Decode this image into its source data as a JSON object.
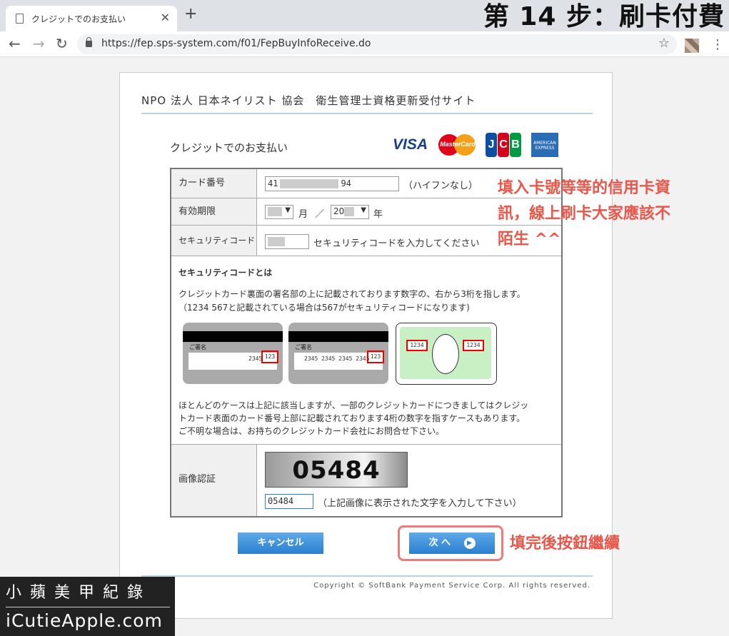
{
  "browser": {
    "tab_title": "クレジットでのお支払い",
    "new_tab": "+",
    "close_tab": "✕",
    "url": "https://fep.sps-system.com/f01/FepBuyInfoReceive.do",
    "nav": {
      "back": "←",
      "forward": "→",
      "reload": "↻"
    },
    "star": "☆",
    "menu": "⋮"
  },
  "step_title": "第 14 步：刷卡付費",
  "page": {
    "site_title": "NPO 法人 日本ネイリスト 協会　衛生管理士資格更新受付サイト",
    "heading": "クレジットでのお支払い",
    "card_brands": {
      "visa": "VISA",
      "mastercard": "MasterCard",
      "jcb": [
        "J",
        "C",
        "B"
      ],
      "amex": "AMERICAN EXPRESS"
    },
    "form": {
      "card_number": {
        "label": "カード番号",
        "value_prefix": "41",
        "value_suffix": "94",
        "note": "（ハイフンなし）"
      },
      "expiry": {
        "label": "有効期限",
        "month_unit": "月",
        "separator": "／",
        "year_prefix": "20",
        "year_unit": "年"
      },
      "security_code": {
        "label": "セキュリティコード",
        "note": "セキュリティコードを入力してください"
      },
      "security_info": {
        "title": "セキュリティコードとは",
        "desc1": "クレジットカード裏面の署名部の上に記載されております数字の、右から3桁を指します。",
        "desc2": "（1234 567と記載されている場合は567がセキュリティコードになります)",
        "sample1": {
          "sign_label": "ご署名",
          "digits": "2345",
          "code": "123"
        },
        "sample2": {
          "sign_label": "ご署名",
          "digits": "2345 2345 2345 2345",
          "code": "123"
        },
        "sample3": {
          "code_left": "1234",
          "code_right": "1234"
        },
        "desc3": "ほとんどのケースは上記に該当しますが、一部のクレジットカードにつきましてはクレジッ",
        "desc4": "トカード表面のカード番号上部に記載されております4桁の数字を指すケースもあります。",
        "desc5": "ご不明な場合は、お持ちのクレジットカード会社にお問合せ下さい。"
      },
      "captcha": {
        "label": "画像認証",
        "image_text": "05484",
        "input_value": "05484",
        "note": "（上記画像に表示された文字を入力して下さい）"
      }
    },
    "buttons": {
      "cancel": "キャンセル",
      "next": "次 へ"
    },
    "copyright": "Copyright © SoftBank Payment Service Corp. All rights reserved."
  },
  "annotations": {
    "fill_lines": [
      "填入卡號等等的信用卡資",
      "訊，線上刷卡大家應該不",
      "陌生 ^^"
    ],
    "next_note": "填完後按鈕繼續"
  },
  "watermark": {
    "line1": "小蘋美甲紀錄",
    "line2": "iCutieApple.com"
  },
  "colors": {
    "accent": "#e8574a",
    "button": "#2a7fce",
    "divider": "#b7d3e3"
  }
}
